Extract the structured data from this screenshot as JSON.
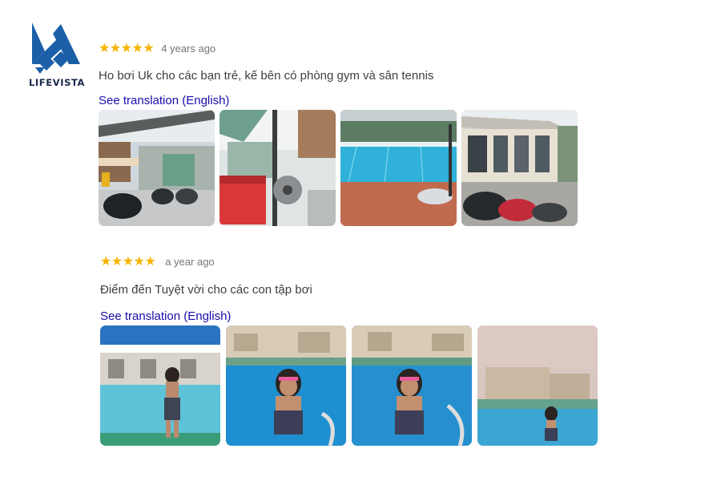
{
  "brand": {
    "logo_text": "LIFEVISTA",
    "icon": "lifevista-logo-icon"
  },
  "colors": {
    "star": "#f6b400",
    "link": "#1a0dab",
    "muted": "#70757a",
    "text": "#3c4043",
    "logo": "#1b5fa8"
  },
  "reviews": [
    {
      "stars": "★★★★★",
      "rating": 5,
      "date": "4 years ago",
      "text": "Ho bơi Uk cho các bạn trẻ, kế bên có phòng gym và sân tennis",
      "translate_label": "See translation (English)",
      "photos": [
        "parking-motorbikes-photo",
        "cooler-and-fan-photo",
        "pool-overview-photo",
        "clubhouse-building-photo"
      ]
    },
    {
      "stars": "★★★★★",
      "rating": 5,
      "date": "a year ago",
      "text": "Điểm đến Tuyệt vời cho các con tập bơi",
      "translate_label": "See translation (English)",
      "photos": [
        "girl-by-pool-photo",
        "girl-in-pool-photo",
        "girl-at-ladder-photo",
        "girl-poolside-distance-photo"
      ]
    }
  ]
}
